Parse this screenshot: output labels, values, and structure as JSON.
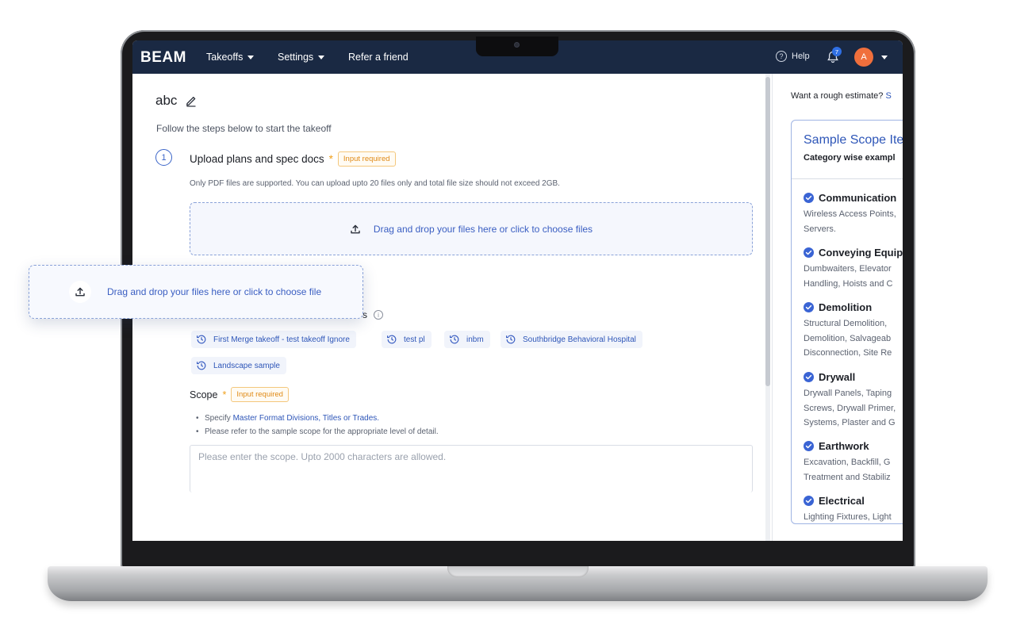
{
  "nav": {
    "logo": "BEAM",
    "items": [
      {
        "label": "Takeoffs",
        "has_caret": true
      },
      {
        "label": "Settings",
        "has_caret": true
      },
      {
        "label": "Refer a friend",
        "has_caret": false
      }
    ],
    "help_label": "Help",
    "notification_count": "7",
    "avatar_initial": "A"
  },
  "main": {
    "title": "abc",
    "subtitle": "Follow the steps below to start the takeoff",
    "step1": {
      "number": "1",
      "title": "Upload plans and spec docs",
      "required_star": "*",
      "badge": "Input required",
      "note": "Only PDF files are supported. You can upload upto 20 files only and total file size should not exceed 2GB.",
      "dropzone_text": "Drag and drop your files here or click to choose files"
    },
    "history_label_fragment": "s",
    "recent_chips": [
      "First Merge takeoff - test takeoff Ignore",
      "test pl",
      "inbm",
      "Southbridge Behavioral Hospital",
      "Landscape sample"
    ],
    "scope": {
      "title": "Scope",
      "required_star": "*",
      "badge": "Input required",
      "bullet1_prefix": "Specify ",
      "bullet1_link": "Master Format Divisions, Titles or Trades.",
      "bullet2": "Please refer to the sample scope for the appropriate level of detail.",
      "placeholder": "Please enter the scope. Upto 2000 characters are allowed."
    }
  },
  "side": {
    "question": "Want a rough estimate?",
    "question_link": "S",
    "card_title": "Sample Scope Ite",
    "card_subtitle": "Category wise exampl",
    "categories": [
      {
        "name": "Communication",
        "desc": "Wireless Access Points, Servers."
      },
      {
        "name": "Conveying Equip",
        "desc": "Dumbwaiters, Elevator Handling, Hoists and C"
      },
      {
        "name": "Demolition",
        "desc": "Structural Demolition, Demolition, Salvageab Disconnection, Site Re"
      },
      {
        "name": "Drywall",
        "desc": "Drywall Panels, Taping Screws, Drywall Primer, Systems, Plaster and G"
      },
      {
        "name": "Earthwork",
        "desc": "Excavation, Backfill, G Treatment and Stabiliz"
      },
      {
        "name": "Electrical",
        "desc": "Lighting Fixtures, Light"
      }
    ]
  },
  "floating_card": {
    "text": "Drag and drop your files here or click to choose file"
  },
  "colors": {
    "nav_bg": "#1a2943",
    "accent": "#2e56b8",
    "badge_orange": "#e08a16",
    "avatar": "#f06f3c"
  }
}
